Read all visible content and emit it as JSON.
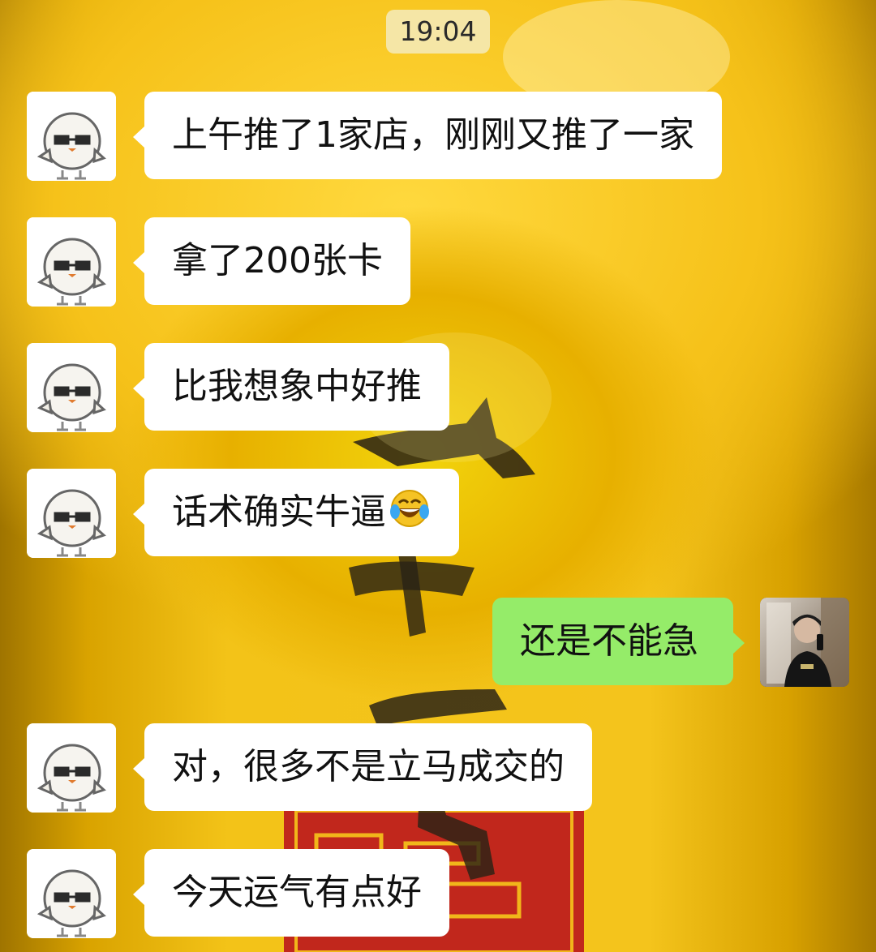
{
  "chat": {
    "timestamp": "19:04",
    "messages": [
      {
        "side": "in",
        "text": "上午推了1家店，刚刚又推了一家",
        "avatar": "chick-sunglasses-avatar"
      },
      {
        "side": "in",
        "text": "拿了200张卡",
        "avatar": "chick-sunglasses-avatar"
      },
      {
        "side": "in",
        "text": "比我想象中好推",
        "avatar": "chick-sunglasses-avatar"
      },
      {
        "side": "in",
        "text": "话术确实牛逼",
        "emoji": "tears-of-joy-emoji",
        "avatar": "chick-sunglasses-avatar"
      },
      {
        "side": "out",
        "text": "还是不能急",
        "avatar": "user-selfie-avatar"
      },
      {
        "side": "in",
        "text": "对，很多不是立马成交的",
        "avatar": "chick-sunglasses-avatar"
      },
      {
        "side": "in",
        "text": "今天运气有点好",
        "avatar": "chick-sunglasses-avatar"
      }
    ]
  },
  "colors": {
    "incoming_bubble": "#ffffff",
    "outgoing_bubble": "#95ec69",
    "background": "#f4c41c"
  }
}
